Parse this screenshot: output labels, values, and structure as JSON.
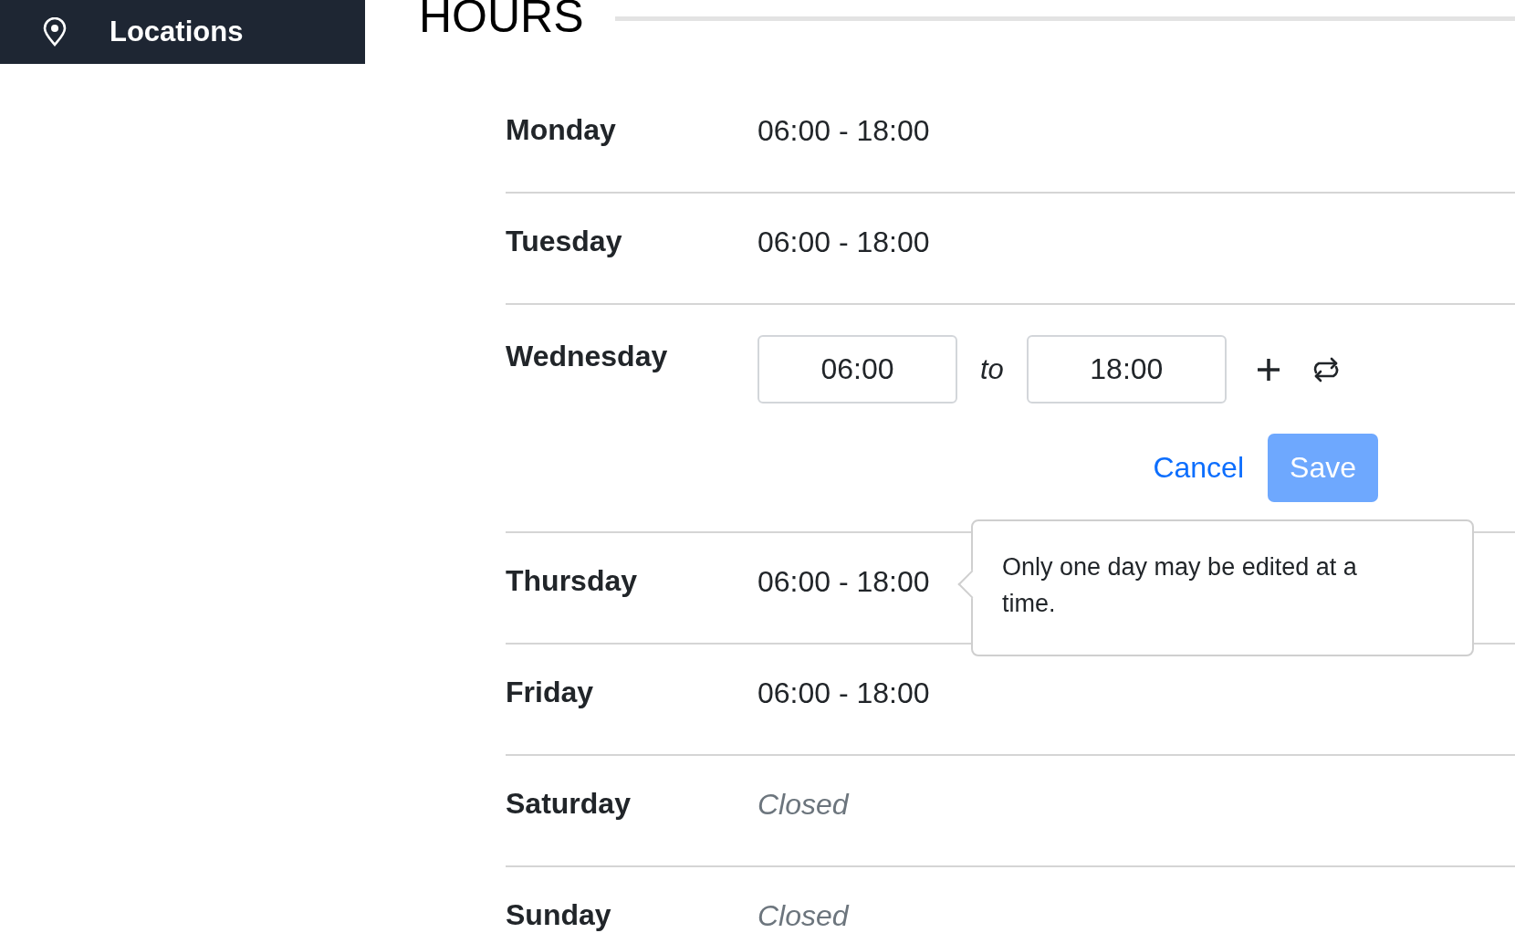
{
  "sidebar": {
    "items": [
      {
        "label": "Locations",
        "selected": true
      }
    ]
  },
  "section": {
    "title": "HOURS"
  },
  "days": [
    {
      "kind": "display",
      "day": "Monday",
      "hours": "06:00 - 18:00"
    },
    {
      "kind": "display",
      "day": "Tuesday",
      "hours": "06:00 - 18:00"
    },
    {
      "kind": "editing",
      "day": "Wednesday",
      "start": "06:00",
      "separator": "to",
      "end": "18:00",
      "cancel": "Cancel",
      "save": "Save",
      "save_disabled": true
    },
    {
      "kind": "display",
      "day": "Thursday",
      "hours": "06:00 - 18:00",
      "tooltip": "Only one day may be edited at a time."
    },
    {
      "kind": "display",
      "day": "Friday",
      "hours": "06:00 - 18:00"
    },
    {
      "kind": "closed",
      "day": "Saturday",
      "hours": "Closed"
    },
    {
      "kind": "closed",
      "day": "Sunday",
      "hours": "Closed"
    }
  ]
}
